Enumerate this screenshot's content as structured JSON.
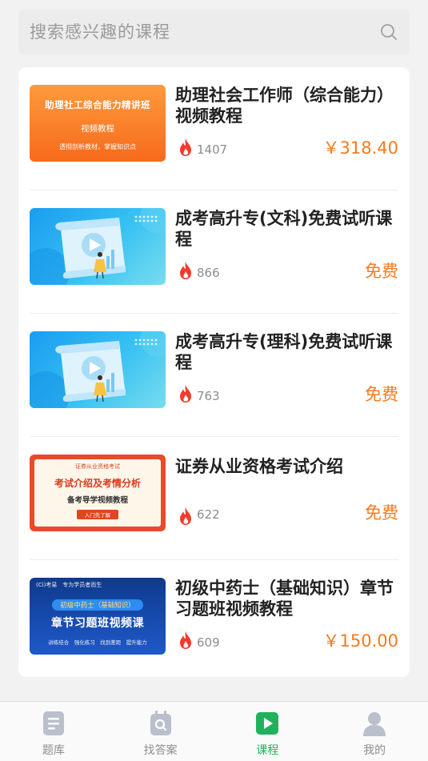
{
  "search": {
    "placeholder": "搜索感兴趣的课程",
    "icon": "search-icon"
  },
  "courses": [
    {
      "title": "助理社会工作师（综合能力）视频教程",
      "views": "1407",
      "price": "￥318.40",
      "thumb": {
        "line1": "助理社工综合能力精讲班",
        "line2": "视频教程",
        "line3": "透彻剖析教材，掌握知识点"
      }
    },
    {
      "title": "成考高升专(文科)免费试听课程",
      "views": "866",
      "price": "免费"
    },
    {
      "title": "成考高升专(理科)免费试听课程",
      "views": "763",
      "price": "免费"
    },
    {
      "title": "证券从业资格考试介绍",
      "views": "622",
      "price": "免费",
      "thumb": {
        "line1": "证券从业资格考试",
        "line2": "考试介绍及考情分析",
        "line3": "备考导学视频教程",
        "line4": "入门先了解"
      }
    },
    {
      "title": "初级中药士（基础知识）章节习题班视频教程",
      "views": "609",
      "price": "￥150.00",
      "thumb": {
        "line1": "(Ci)考易　专为学员者而生",
        "line2": "初级中药士（基础知识）",
        "line3": "章节习题班视频课",
        "line4": "讲练结合　强化练习　找到差距　提升能力"
      }
    }
  ],
  "tabs": [
    {
      "label": "题库",
      "icon": "question-bank-icon"
    },
    {
      "label": "找答案",
      "icon": "find-answer-icon"
    },
    {
      "label": "课程",
      "icon": "course-play-icon",
      "active": true
    },
    {
      "label": "我的",
      "icon": "profile-icon"
    }
  ],
  "colors": {
    "accent": "#21b15c",
    "price": "#f57a1f",
    "fire": "#f23b2a"
  }
}
